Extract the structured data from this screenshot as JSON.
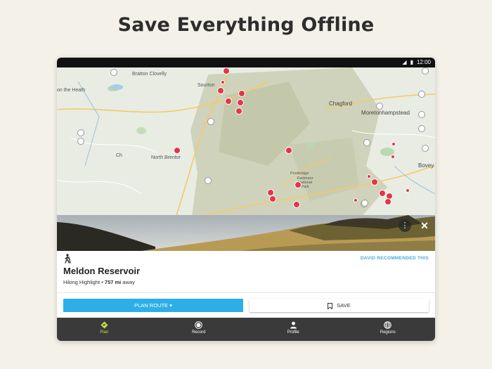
{
  "headline": "Save Everything Offline",
  "status": {
    "time": "12:00"
  },
  "map": {
    "labels": [
      "Bratton Clovelly",
      "Sourton",
      "Chagford",
      "Moretonhampstead",
      "North Brentor",
      "Dartmoor National Park",
      "Bovey",
      "on the Heath",
      "Ch",
      "Postbridge"
    ]
  },
  "card": {
    "recommended": "DAVID RECOMMENDED THIS",
    "title": "Meldon Reservoir",
    "subtitle_prefix": "Hiking Highlight • ",
    "distance": "757 mi",
    "subtitle_suffix": " away",
    "plan_route_label": "PLAN ROUTE ▾",
    "save_label": "SAVE"
  },
  "nav": {
    "plan": "Plan",
    "record": "Record",
    "profile": "Profile",
    "regions": "Regions"
  },
  "colors": {
    "accent": "#2eaee7",
    "pin": "#e0374a",
    "nav_active": "#c9dd50",
    "nav_bg": "#3a3a3a"
  }
}
